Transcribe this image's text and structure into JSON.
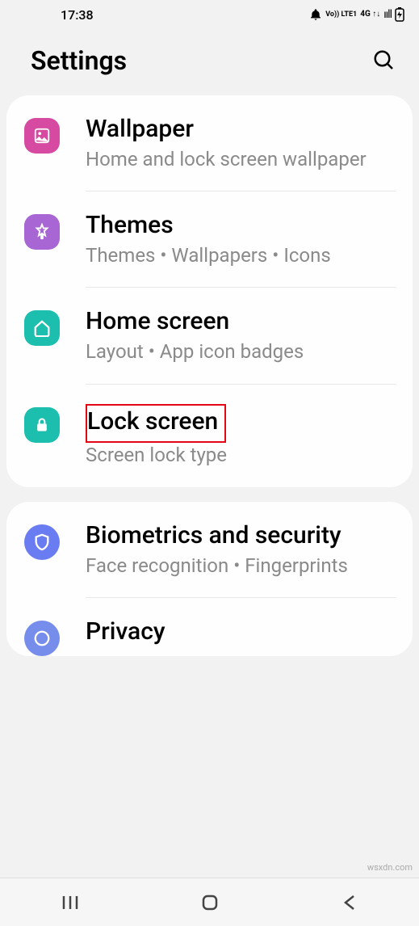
{
  "status": {
    "time": "17:38",
    "alarm": "⏰",
    "volte": "Vo)) LTE1",
    "net": "4G ↑↓",
    "signal": "ııll",
    "battery": "⚡"
  },
  "header": {
    "title": "Settings"
  },
  "groups": [
    {
      "items": [
        {
          "id": "wallpaper",
          "title": "Wallpaper",
          "subtitle": "Home and lock screen wallpaper"
        },
        {
          "id": "themes",
          "title": "Themes",
          "subtitle": "Themes  •  Wallpapers  •  Icons"
        },
        {
          "id": "home-screen",
          "title": "Home screen",
          "subtitle": "Layout  •  App icon badges"
        },
        {
          "id": "lock-screen",
          "title": "Lock screen",
          "subtitle": "Screen lock type",
          "highlighted": true
        }
      ]
    },
    {
      "items": [
        {
          "id": "biometrics",
          "title": "Biometrics and security",
          "subtitle": "Face recognition  •  Fingerprints"
        },
        {
          "id": "privacy",
          "title": "Privacy",
          "subtitle": ""
        }
      ]
    }
  ],
  "watermark": "wsxdn.com"
}
